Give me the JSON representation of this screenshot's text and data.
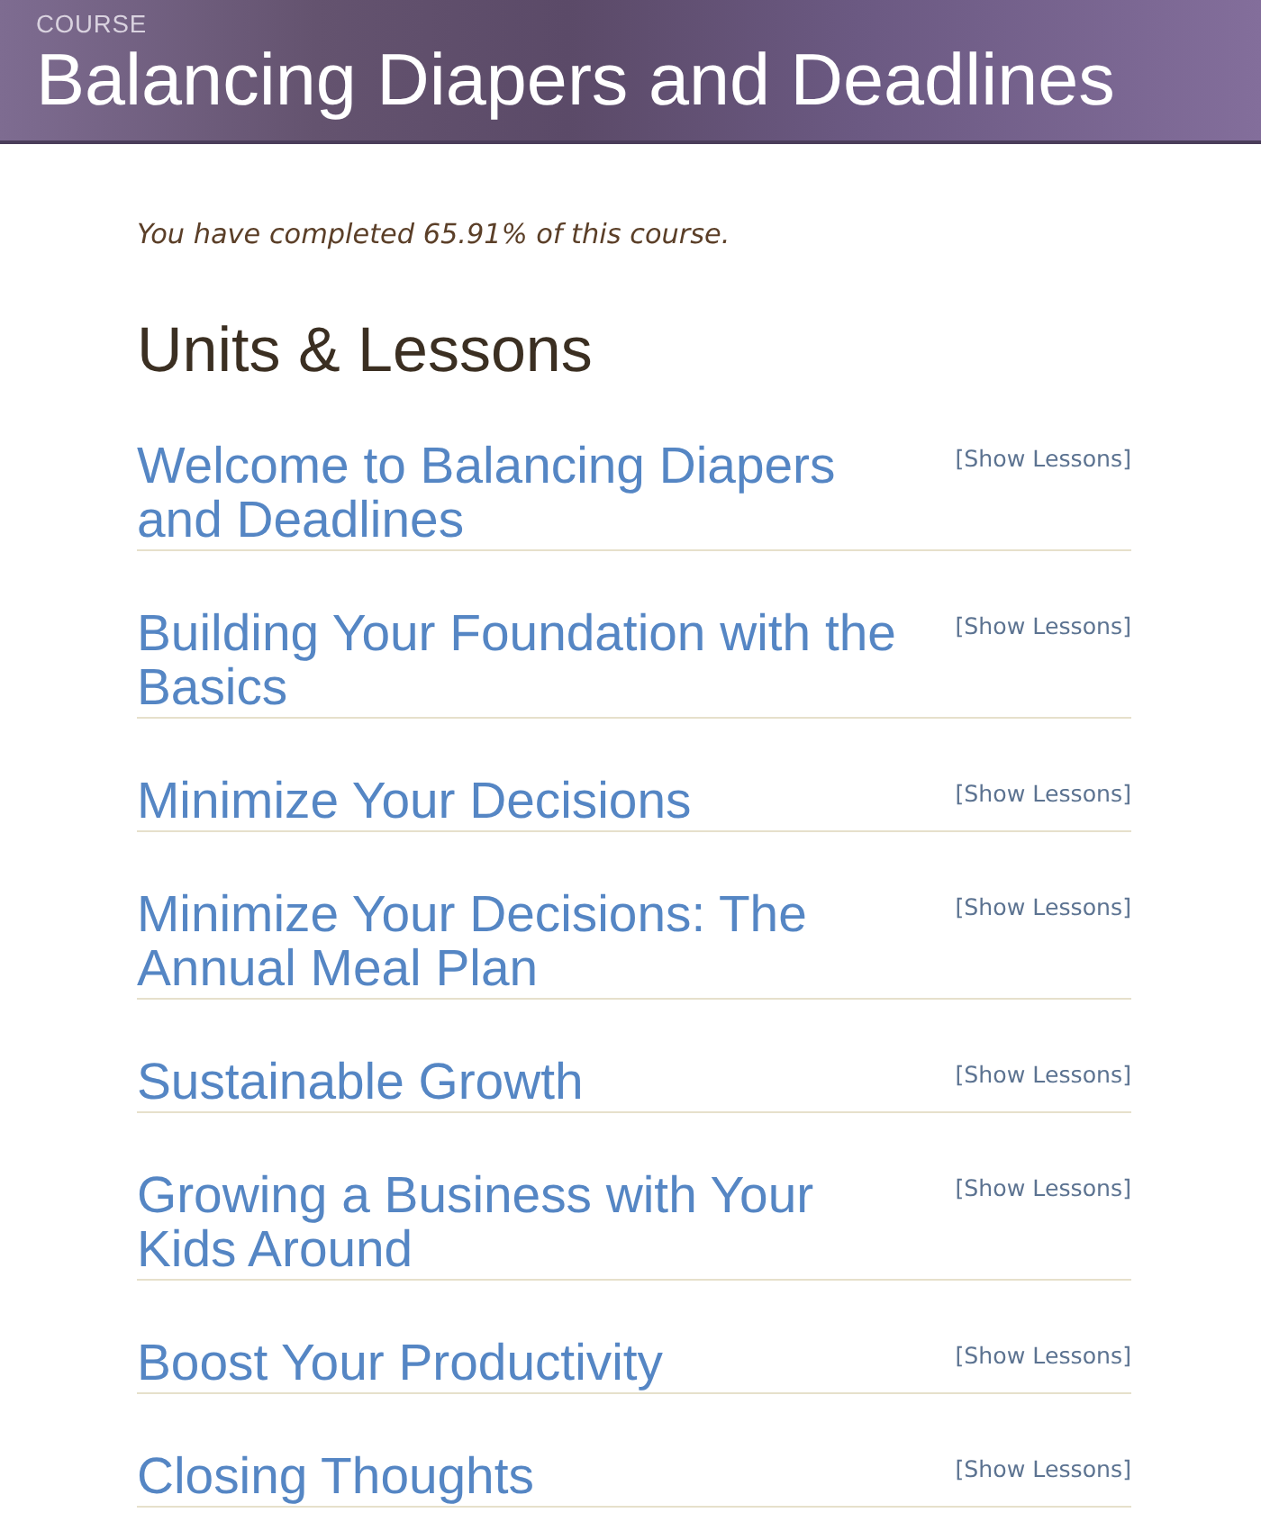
{
  "header": {
    "label": "COURSE",
    "title": "Balancing Diapers and Deadlines"
  },
  "progress_text": "You have completed 65.91% of this course.",
  "section_title": "Units & Lessons",
  "units": [
    {
      "title": "Welcome to Balancing Diapers and Deadlines",
      "toggle": "[Show Lessons]"
    },
    {
      "title": "Building Your Foundation with the Basics",
      "toggle": "[Show Lessons]"
    },
    {
      "title": "Minimize Your Decisions",
      "toggle": "[Show Lessons]"
    },
    {
      "title": "Minimize Your Decisions: The Annual Meal Plan",
      "toggle": "[Show Lessons]"
    },
    {
      "title": "Sustainable Growth",
      "toggle": "[Show Lessons]"
    },
    {
      "title": "Growing a Business with Your Kids Around",
      "toggle": "[Show Lessons]"
    },
    {
      "title": "Boost Your Productivity",
      "toggle": "[Show Lessons]"
    },
    {
      "title": "Closing Thoughts",
      "toggle": "[Show Lessons]"
    }
  ]
}
